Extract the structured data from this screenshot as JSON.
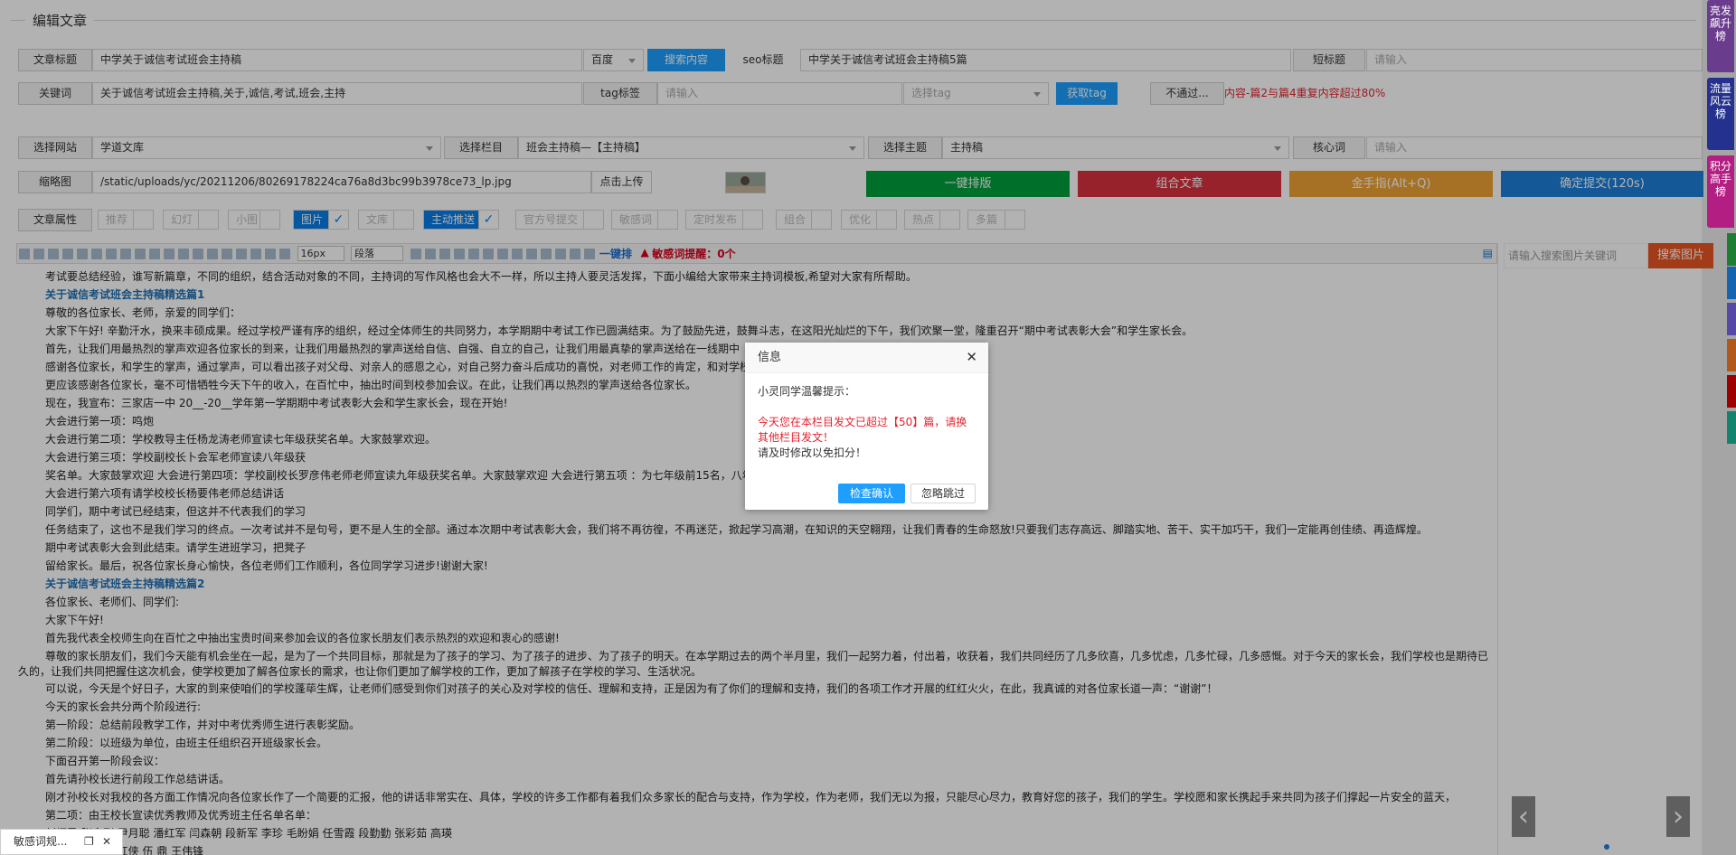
{
  "section_title": "编辑文章",
  "form": {
    "title_label": "文章标题",
    "title_value": "中学关于诚信考试班会主持稿",
    "engine_value": "百度",
    "search_content_button": "搜索内容",
    "seo_label": "seo标题",
    "seo_value": "中学关于诚信考试班会主持稿5篇",
    "short_title_label": "短标题",
    "short_title_placeholder": "请输入",
    "keywords_label": "关键词",
    "keywords_value": "关于诚信考试班会主持稿,关于,诚信,考试,班会,主持",
    "tag_label": "tag标签",
    "tag_placeholder": "请输入",
    "tag_select_placeholder": "选择tag",
    "get_tag_button": "获取tag",
    "status_value": "不通过...",
    "repeat_warning": "内容-篇2与篇4重复内容超过80%",
    "site_label": "选择网站",
    "site_value": "学道文库",
    "column_label": "选择栏目",
    "column_value": "班会主持稿—【主持稿】",
    "topic_label": "选择主题",
    "topic_value": "主持稿",
    "core_label": "核心词",
    "core_placeholder": "请输入",
    "thumb_label": "缩略图",
    "thumb_value": "/static/uploads/yc/20211206/80269178224ca76a8d3bc99b3978ce73_lp.jpg",
    "upload_button": "点击上传"
  },
  "actions": {
    "one_click_layout": "一键排版",
    "combine_article": "组合文章",
    "golden_finger": "金手指(Alt+Q)",
    "confirm_submit": "确定提交(120s)"
  },
  "attributes": {
    "label": "文章属性",
    "items": [
      {
        "label": "推荐",
        "on": false
      },
      {
        "label": "幻灯",
        "on": false
      },
      {
        "label": "小图",
        "on": false
      },
      {
        "label": "图片",
        "on": true
      },
      {
        "label": "文库",
        "on": false
      },
      {
        "label": "主动推送",
        "on": true
      },
      {
        "label": "官方号提交",
        "on": false
      },
      {
        "label": "敏感词",
        "on": false
      },
      {
        "label": "定时发布",
        "on": false
      },
      {
        "label": "组合",
        "on": false
      },
      {
        "label": "优化",
        "on": false
      },
      {
        "label": "热点",
        "on": false
      },
      {
        "label": "多篇",
        "on": false
      }
    ]
  },
  "toolbar": {
    "font_size": "16px",
    "paragraph": "段落",
    "one_key": "一键排",
    "sensitive_label": "敏感词提醒：0个"
  },
  "content": [
    {
      "t": "考试要总结经验，谁写新篇章，不同的组织，结合活动对象的不同，主持词的写作风格也会大不一样，所以主持人要灵活发挥，下面小编给大家带来主持词模板,希望对大家有所帮助。",
      "h": false
    },
    {
      "t": "关于诚信考试班会主持稿精选篇1",
      "h": true
    },
    {
      "t": "尊敬的各位家长、老师，亲爱的同学们：",
      "h": false
    },
    {
      "t": "大家下午好! 辛勤汗水，换来丰硕成果。经过学校严谨有序的组织，经过全体师生的共同努力，本学期期中考试工作已圆满结束。为了鼓励先进，鼓舞斗志，在这阳光灿烂的下午，我们欢聚一堂，隆重召开“期中考试表彰大会”和学生家长会。",
      "h": false
    },
    {
      "t": "首先，让我们用最热烈的掌声欢迎各位家长的到来，让我们用最热烈的掌声送给自信、自强、自立的自己，让我们用最真挚的掌声送给在一线期中",
      "h": false
    },
    {
      "t": "感谢各位家长，和学生的掌声，通过掌声，可以看出孩子对父母、对亲人的感恩之心，对自己努力奋斗后成功的喜悦，对老师工作的肯定，和对学校",
      "h": false
    },
    {
      "t": "更应该感谢各位家长，毫不可惜牺牲今天下午的收入，在百忙中，抽出时间到校参加会议。在此，让我们再以热烈的掌声送给各位家长。",
      "h": false
    },
    {
      "t": "现在，我宣布：三家店一中 20__-20__学年第一学期期中考试表彰大会和学生家长会，现在开始!",
      "h": false
    },
    {
      "t": "大会进行第一项：鸣炮",
      "h": false
    },
    {
      "t": "大会进行第二项：学校教导主任杨龙涛老师宣读七年级获奖名单。大家鼓掌欢迎。",
      "h": false
    },
    {
      "t": "大会进行第三项：学校副校长卜会军老师宣读八年级获",
      "h": false
    },
    {
      "t": "奖名单。大家鼓掌欢迎 大会进行第四项：学校副校长罗彦伟老师老师宣读九年级获奖名单。大家鼓掌欢迎 大会进行第五项 ：为七年级前15名，八年",
      "h": false
    },
    {
      "t": "大会进行第六项有请学校校长杨要伟老师总结讲话",
      "h": false
    },
    {
      "t": "同学们，期中考试已经结束，但这并不代表我们的学习",
      "h": false
    },
    {
      "t": "任务结束了，这也不是我们学习的终点。一次考试并不是句号，更不是人生的全部。通过本次期中考试表彰大会，我们将不再彷徨，不再迷茫，掀起学习高潮，在知识的天空翱翔，让我们青春的生命怒放!只要我们志存高远、脚踏实地、苦干、实干加巧干，我们一定能再创佳绩、再造辉煌。",
      "h": false
    },
    {
      "t": "期中考试表彰大会到此结束。请学生进班学习，把凳子",
      "h": false
    },
    {
      "t": "留给家长。最后，祝各位家长身心愉快，各位老师们工作顺利，各位同学学习进步!谢谢大家!",
      "h": false
    },
    {
      "t": "关于诚信考试班会主持稿精选篇2",
      "h": true
    },
    {
      "t": "各位家长、老师们、同学们:",
      "h": false
    },
    {
      "t": "大家下午好!",
      "h": false
    },
    {
      "t": "首先我代表全校师生向在百忙之中抽出宝贵时间来参加会议的各位家长朋友们表示热烈的欢迎和衷心的感谢!",
      "h": false
    },
    {
      "t": "尊敬的家长朋友们，我们今天能有机会坐在一起，是为了一个共同目标，那就是为了孩子的学习、为了孩子的进步、为了孩子的明天。在本学期过去的两个半月里，我们一起努力着，付出着，收获着，我们共同经历了几多欣喜，几多忧虑，几多忙碌，几多感慨。对于今天的家长会，我们学校也是期待已久的，让我们共同把握住这次机会，使学校更加了解各位家长的需求，也让你们更加了解学校的工作，更加了解孩子在学校的学习、生活状况。",
      "h": false,
      "wrap": true
    },
    {
      "t": "可以说，今天是个好日子，大家的到来使咱们的学校蓬荜生辉，让老师们感受到你们对孩子的关心及对学校的信任、理解和支持，正是因为有了你们的理解和支持，我们的各项工作才开展的红红火火，在此，我真诚的对各位家长道一声：“谢谢”！",
      "h": false
    },
    {
      "t": "今天的家长会共分两个阶段进行:",
      "h": false
    },
    {
      "t": "第一阶段：总结前段教学工作，并对中考优秀师生进行表彰奖励。",
      "h": false
    },
    {
      "t": "第二阶段：以班级为单位，由班主任组织召开班级家长会。",
      "h": false
    },
    {
      "t": "下面召开第一阶段会议：",
      "h": false
    },
    {
      "t": "首先请孙校长进行前段工作总结讲话。",
      "h": false
    },
    {
      "t": "刚才孙校长对我校的各方面工作情况向各位家长作了一个简要的汇报，他的讲话非常实在、具体，学校的许多工作都有着我们众多家长的配合与支持，作为学校，作为老师，我们无以为报，只能尽心尽力，教育好您的孩子，我们的学生。学校愿和家长携起手来共同为孩子们撑起一片安全的蓝天，",
      "h": false
    },
    {
      "t": "第二项：由王校长宣读优秀教师及优秀班主任名单名单：",
      "h": false
    },
    {
      "t": "刘炳勇 张今刚 尹月聪 潘红军 闫森朝 段新军 李珍 毛盼娟 任雪霞 段勤勤 张彩茹 高瑛",
      "h": false
    },
    {
      "t": "周义 朱玉槐 李红侠 伍 鼎 王伟锋",
      "h": false
    }
  ],
  "image_panel": {
    "search_placeholder": "请输入搜索图片关键词",
    "search_button": "搜索图片"
  },
  "dialog": {
    "title": "信息",
    "greeting": "小灵同学温馨提示：",
    "warning": "今天您在本栏目发文已超过【50】篇，请换其他栏目发文！",
    "note": "请及时修改以免扣分！",
    "confirm_button": "检查确认",
    "skip_button": "忽略跳过"
  },
  "right_sidebar": [
    {
      "label": "亮发飙升榜",
      "color": "#6a3c8e"
    },
    {
      "label": "流量风云榜",
      "color": "#24318e"
    },
    {
      "label": "积分高手榜",
      "color": "#b31e82"
    }
  ],
  "minimized": {
    "label": "敏感词规..."
  }
}
